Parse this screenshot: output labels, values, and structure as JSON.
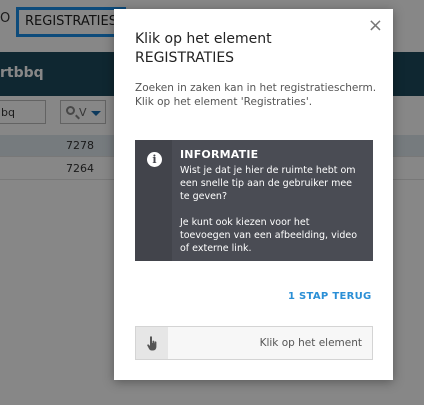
{
  "background": {
    "partial_tab": "O",
    "active_tab": "REGISTRATIES",
    "header_title": "rtbbq",
    "filter_value": "bq",
    "filter_select": "V",
    "rows": [
      {
        "number": "7278"
      },
      {
        "number": "7264"
      }
    ]
  },
  "modal": {
    "close_symbol": "×",
    "title_line1": "Klik op het element",
    "title_line2": "REGISTRATIES",
    "description_line1": "Zoeken in zaken kan in het registratiescherm.",
    "description_line2": "Klik op het element 'Registraties'.",
    "info": {
      "icon": "i",
      "heading": "INFORMATIE",
      "text1_line1": "Wist je dat je hier de ruimte hebt om",
      "text1_line2": "een snelle tip aan de gebruiker mee",
      "text1_line3": "te geven?",
      "text2_line1": "Je kunt ook kiezen voor het",
      "text2_line2": "toevoegen van een afbeelding, video",
      "text2_line3": "of externe link."
    },
    "back_label": "1 STAP TERUG",
    "action_label": "Klik op het element"
  },
  "colors": {
    "accent": "#2a8fd6",
    "tab_highlight": "#1a8fe8",
    "info_bg": "#4a4c54",
    "header_bg": "#1d4a5e"
  },
  "icons": {
    "close": "close-icon",
    "info": "info-icon",
    "hand": "hand-pointer-icon",
    "search": "search-icon"
  }
}
